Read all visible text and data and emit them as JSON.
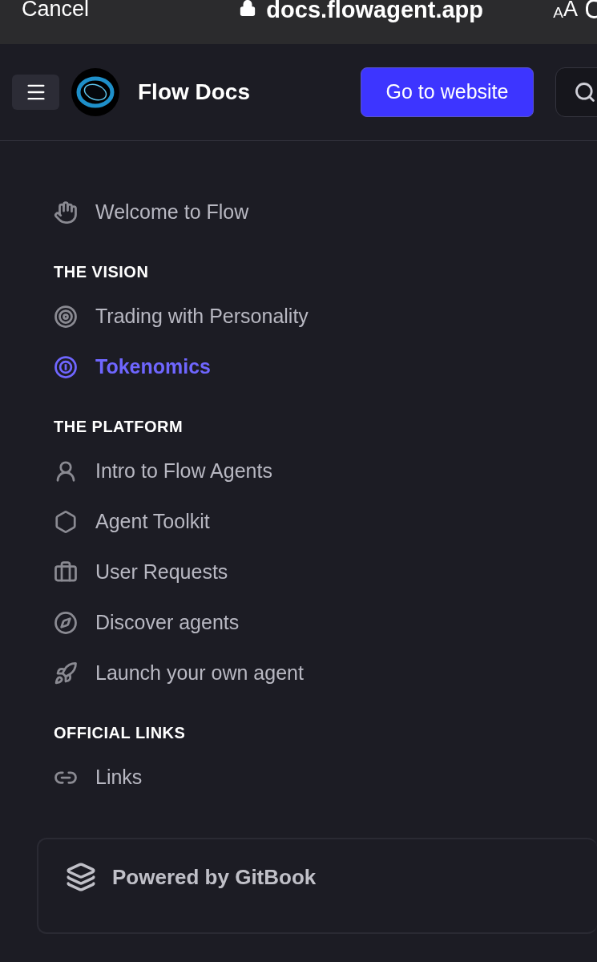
{
  "browser_bar": {
    "cancel": "Cancel",
    "url": "docs.flowagent.app",
    "text_size_small": "A",
    "text_size_large": "A"
  },
  "header": {
    "title": "Flow Docs",
    "website_button": "Go to website"
  },
  "sections": [
    {
      "items": [
        {
          "label": "Welcome to Flow",
          "selected": false
        }
      ]
    },
    {
      "heading": "THE VISION",
      "items": [
        {
          "label": "Trading with Personality",
          "selected": false
        },
        {
          "label": "Tokenomics",
          "selected": true
        }
      ]
    },
    {
      "heading": "THE PLATFORM",
      "items": [
        {
          "label": "Intro to Flow Agents",
          "selected": false
        },
        {
          "label": "Agent Toolkit",
          "selected": false
        },
        {
          "label": "User Requests",
          "selected": false
        },
        {
          "label": "Discover agents",
          "selected": false
        },
        {
          "label": "Launch your own agent",
          "selected": false
        }
      ]
    },
    {
      "heading": "OFFICIAL LINKS",
      "items": [
        {
          "label": "Links",
          "selected": false
        }
      ]
    }
  ],
  "footer": {
    "label": "Powered by GitBook"
  }
}
